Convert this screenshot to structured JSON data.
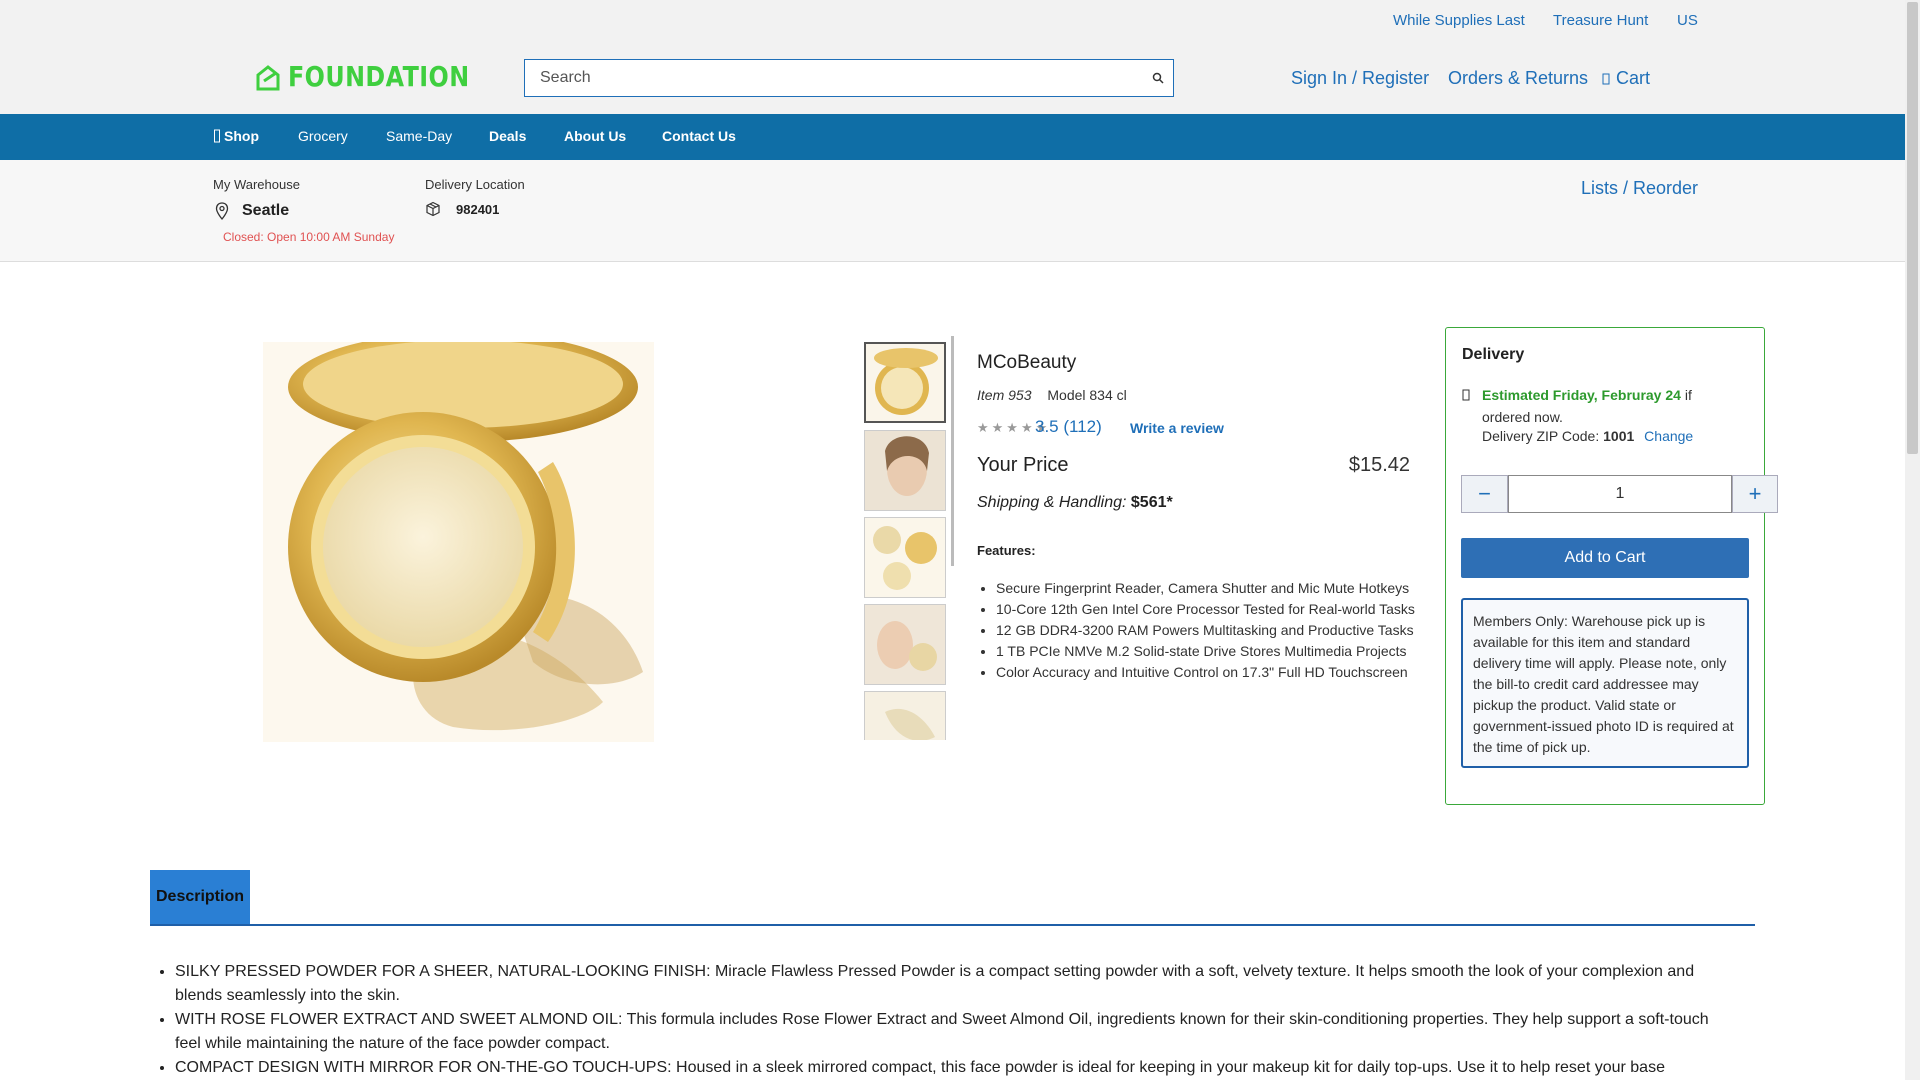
{
  "header": {
    "util_links": [
      "While Supplies Last",
      "Treasure Hunt",
      "US"
    ],
    "logo_text": "FOUNDATION",
    "search": {
      "placeholder": "Search",
      "value": ""
    },
    "account_links": {
      "sign_in": "Sign In / Register",
      "orders": "Orders & Returns",
      "cart": "Cart"
    }
  },
  "nav": {
    "items": [
      "Shop",
      "Grocery",
      "Same-Day",
      "Deals",
      "About Us",
      "Contact Us"
    ]
  },
  "warehouse": {
    "label": "My Warehouse",
    "city": "Seatle",
    "status": "Closed: Open 10:00 AM Sunday",
    "delivery_label": "Delivery Location",
    "zip": "982401",
    "lists_link": "Lists / Reorder"
  },
  "product": {
    "brand": "MCoBeauty",
    "item_label": "Item 953",
    "model_label": "Model 834 cl",
    "stars": "★★★★★",
    "rating": "3.5 (112)",
    "write_review": "Write a review",
    "price_label": "Your Price",
    "price": "$15.42",
    "shipping_label": "Shipping & Handling:",
    "shipping_value": "$561*",
    "features_label": "Features:",
    "features": [
      "Secure Fingerprint Reader, Camera Shutter and Mic Mute Hotkeys",
      "10-Core 12th Gen Intel Core Processor Tested for Real-world Tasks",
      "12 GB DDR4-3200 RAM Powers Multitasking and Productive Tasks",
      "1 TB PCIe NMVe M.2 Solid-state Drive Stores Multimedia Projects",
      "Color Accuracy and Intuitive Control on 17.3\" Full HD Touchscreen"
    ]
  },
  "delivery": {
    "title": "Delivery",
    "estimate_bold": "Estimated Friday, Februray 24",
    "estimate_rest": " if ordered now.",
    "zip_label": "Delivery ZIP Code: ",
    "zip": "1001",
    "change": "Change",
    "qty_minus": "−",
    "qty_value": "1",
    "qty_plus": "+",
    "add_to_cart": "Add to Cart",
    "members_note": "Members Only: Warehouse pick up is available for this item and standard delivery time will apply. Please note, only the bill-to credit card addressee may pickup the product. Valid state or government-issued photo ID is required at the time of pick up."
  },
  "tabs": {
    "description": "Description"
  },
  "description": [
    "SILKY PRESSED POWDER FOR A SHEER, NATURAL-LOOKING FINISH: Miracle Flawless Pressed Powder is a compact setting powder with a soft, velvety texture. It helps smooth the look of your complexion and blends seamlessly into the skin.",
    "WITH ROSE FLOWER EXTRACT AND SWEET ALMOND OIL: This formula includes Rose Flower Extract and Sweet Almond Oil, ingredients known for their skin-conditioning properties. They help support a soft-touch feel while maintaining the nature of the face powder compact.",
    "COMPACT DESIGN WITH MIRROR FOR ON-THE-GO TOUCH-UPS: Housed in a sleek mirrored compact, this face powder is ideal for keeping in your makeup kit for daily top-ups. Use it to help reset your base throughout"
  ],
  "colors": {
    "link": "#1f6fb8",
    "nav_bg": "#0f6ea6",
    "logo_green": "#3fcf3f",
    "estimate_green": "#2d9a2d",
    "status_red": "#e05252",
    "button_blue": "#2e6fb5"
  }
}
